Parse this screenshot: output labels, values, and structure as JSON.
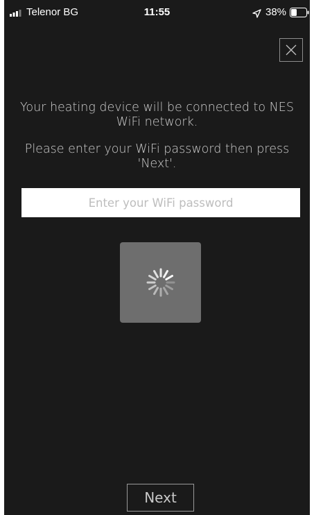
{
  "status_bar": {
    "carrier": "Telenor BG",
    "time": "11:55",
    "battery_percent": "38%",
    "battery_level": 0.38
  },
  "dialog": {
    "connect_message": "Your heating device will be connected to NES WiFi network.",
    "password_message": "Please enter your WiFi password then press 'Next'.",
    "password_input": {
      "placeholder": "Enter your WiFi password",
      "value": ""
    },
    "next_label": "Next"
  },
  "colors": {
    "background": "#1a1a1a",
    "spinner_box": "#6e6e6e",
    "input_background": "#ffffff"
  },
  "icons": {
    "signal": "signal-bars-icon",
    "location": "location-arrow-icon",
    "battery": "battery-icon",
    "close": "close-icon",
    "spinner": "loading-spinner-icon"
  }
}
